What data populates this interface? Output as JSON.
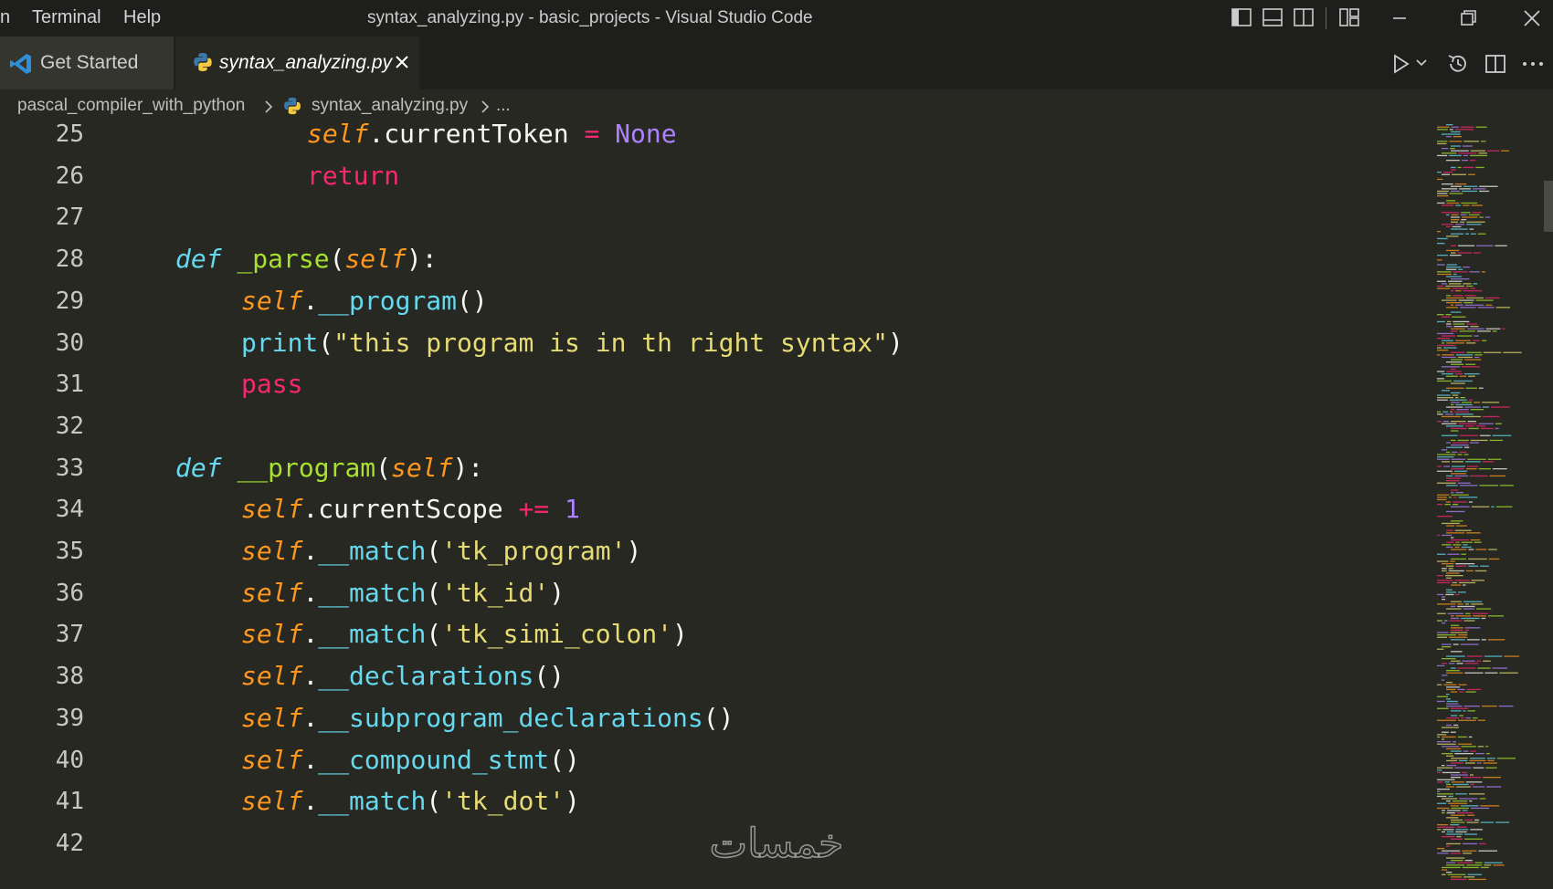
{
  "menu": {
    "partial": "n",
    "terminal": "Terminal",
    "help": "Help"
  },
  "window": {
    "title": "syntax_analyzing.py - basic_projects - Visual Studio Code"
  },
  "tabs": [
    {
      "label": "Get Started",
      "icon": "vscode-logo-icon",
      "active": false
    },
    {
      "label": "syntax_analyzing.py",
      "icon": "python-icon",
      "active": true
    }
  ],
  "breadcrumb": {
    "folder": "pascal_compiler_with_python",
    "file": "syntax_analyzing.py",
    "more": "..."
  },
  "editor": {
    "lines": [
      {
        "n": "25",
        "indent": 3,
        "tokens": [
          [
            "self",
            "self"
          ],
          [
            "punc",
            "."
          ],
          [
            "plain",
            "currentToken "
          ],
          [
            "op",
            "="
          ],
          [
            "plain",
            " "
          ],
          [
            "const",
            "None"
          ]
        ]
      },
      {
        "n": "26",
        "indent": 3,
        "tokens": [
          [
            "kw",
            "return"
          ]
        ]
      },
      {
        "n": "27",
        "indent": 0,
        "tokens": []
      },
      {
        "n": "28",
        "indent": 1,
        "tokens": [
          [
            "def",
            "def"
          ],
          [
            "plain",
            " "
          ],
          [
            "fn",
            "_parse"
          ],
          [
            "punc",
            "("
          ],
          [
            "self",
            "self"
          ],
          [
            "punc",
            "):"
          ]
        ]
      },
      {
        "n": "29",
        "indent": 2,
        "tokens": [
          [
            "self",
            "self"
          ],
          [
            "punc",
            "."
          ],
          [
            "call",
            "__program"
          ],
          [
            "punc",
            "()"
          ]
        ]
      },
      {
        "n": "30",
        "indent": 2,
        "tokens": [
          [
            "call",
            "print"
          ],
          [
            "punc",
            "("
          ],
          [
            "str",
            "\"this program is in th right syntax\""
          ],
          [
            "punc",
            ")"
          ]
        ]
      },
      {
        "n": "31",
        "indent": 2,
        "tokens": [
          [
            "kw",
            "pass"
          ]
        ]
      },
      {
        "n": "32",
        "indent": 0,
        "tokens": []
      },
      {
        "n": "33",
        "indent": 1,
        "tokens": [
          [
            "def",
            "def"
          ],
          [
            "plain",
            " "
          ],
          [
            "fn",
            "__program"
          ],
          [
            "punc",
            "("
          ],
          [
            "self",
            "self"
          ],
          [
            "punc",
            "):"
          ]
        ]
      },
      {
        "n": "34",
        "indent": 2,
        "tokens": [
          [
            "self",
            "self"
          ],
          [
            "punc",
            "."
          ],
          [
            "plain",
            "currentScope "
          ],
          [
            "op",
            "+="
          ],
          [
            "plain",
            " "
          ],
          [
            "num",
            "1"
          ]
        ]
      },
      {
        "n": "35",
        "indent": 2,
        "tokens": [
          [
            "self",
            "self"
          ],
          [
            "punc",
            "."
          ],
          [
            "call",
            "__match"
          ],
          [
            "punc",
            "("
          ],
          [
            "str",
            "'tk_program'"
          ],
          [
            "punc",
            ")"
          ]
        ]
      },
      {
        "n": "36",
        "indent": 2,
        "tokens": [
          [
            "self",
            "self"
          ],
          [
            "punc",
            "."
          ],
          [
            "call",
            "__match"
          ],
          [
            "punc",
            "("
          ],
          [
            "str",
            "'tk_id'"
          ],
          [
            "punc",
            ")"
          ]
        ]
      },
      {
        "n": "37",
        "indent": 2,
        "tokens": [
          [
            "self",
            "self"
          ],
          [
            "punc",
            "."
          ],
          [
            "call",
            "__match"
          ],
          [
            "punc",
            "("
          ],
          [
            "str",
            "'tk_simi_colon'"
          ],
          [
            "punc",
            ")"
          ]
        ]
      },
      {
        "n": "38",
        "indent": 2,
        "tokens": [
          [
            "self",
            "self"
          ],
          [
            "punc",
            "."
          ],
          [
            "call",
            "__declarations"
          ],
          [
            "punc",
            "()"
          ]
        ]
      },
      {
        "n": "39",
        "indent": 2,
        "tokens": [
          [
            "self",
            "self"
          ],
          [
            "punc",
            "."
          ],
          [
            "call",
            "__subprogram_declarations"
          ],
          [
            "punc",
            "()"
          ]
        ]
      },
      {
        "n": "40",
        "indent": 2,
        "tokens": [
          [
            "self",
            "self"
          ],
          [
            "punc",
            "."
          ],
          [
            "call",
            "__compound_stmt"
          ],
          [
            "punc",
            "()"
          ]
        ]
      },
      {
        "n": "41",
        "indent": 2,
        "tokens": [
          [
            "self",
            "self"
          ],
          [
            "punc",
            "."
          ],
          [
            "call",
            "__match"
          ],
          [
            "punc",
            "("
          ],
          [
            "str",
            "'tk_dot'"
          ],
          [
            "punc",
            ")"
          ]
        ]
      },
      {
        "n": "42",
        "indent": 0,
        "tokens": []
      }
    ]
  },
  "watermark": {
    "text": "خمسات"
  },
  "colors": {
    "background": "#272822",
    "keyword": "#f92672",
    "function": "#a6e22e",
    "self": "#fd971f",
    "call": "#66d9ef",
    "string": "#e6db74",
    "number": "#ae81ff"
  }
}
